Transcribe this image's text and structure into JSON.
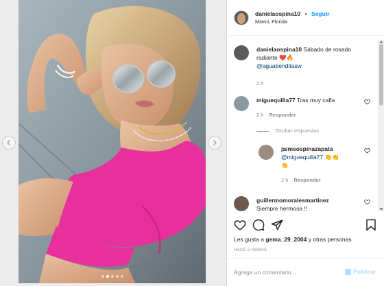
{
  "post": {
    "username": "danielaospina10",
    "separator": "•",
    "follow_label": "Seguir",
    "location": "Miami, Florida",
    "caption_text": "Sábado de rosado radiante",
    "caption_emoji": "❤️🔥",
    "caption_mention": "@aguabenditasw",
    "caption_time": "2 h",
    "carousel_dots": 5,
    "carousel_active": 2
  },
  "comments": [
    {
      "username": "miguequilla77",
      "text": "Tras muy cafla",
      "time": "2 h",
      "reply_label": "Responder"
    }
  ],
  "replies_toggle": "Ocultar respuestas",
  "reply": {
    "username": "jaimeospinazapata",
    "mention": "@miguequilla77",
    "emoji": "👏👏",
    "emoji_line2": "👏",
    "time": "2 h",
    "reply_label": "Responder"
  },
  "comment3": {
    "username": "guillermomoralesmartinez",
    "text": "Siempre hermosa !!"
  },
  "likes": {
    "prefix": "Les gusta a",
    "user": "gema_29_2004",
    "suffix": "y otras personas"
  },
  "timestamp": "HACE 2 HORAS",
  "add_comment": {
    "placeholder": "Agrega un comentario...",
    "publish_label": "Publicar"
  },
  "colors": {
    "accent": "#0095f6",
    "swimsuit": "#e8309c",
    "text": "#262626",
    "muted": "#8e8e8e"
  }
}
